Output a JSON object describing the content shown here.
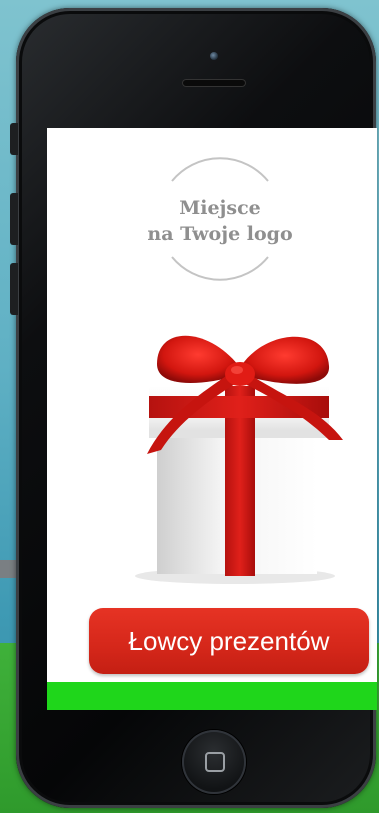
{
  "logo_placeholder": {
    "line1": "Miejsce",
    "line2": "na Twoje logo"
  },
  "cta": {
    "label": "Łowcy prezentów"
  },
  "images": {
    "gift": "gift-box-with-red-ribbon",
    "home": "home-button-icon"
  },
  "colors": {
    "cta_red": "#d5271a",
    "bottom_bar_green": "#1fd61b",
    "logo_text_grey": "#8f8f8f",
    "background_blue": "#5fb0c4",
    "grass_green": "#3fb13a"
  }
}
